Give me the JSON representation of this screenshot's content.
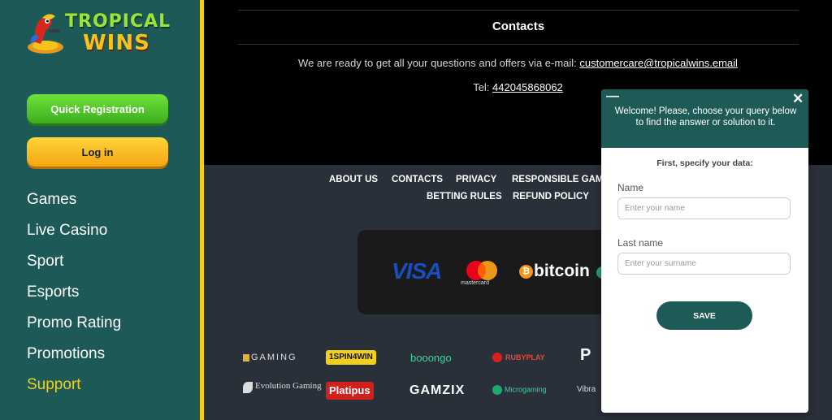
{
  "brand": {
    "line1": "TROPICAL",
    "line2": "WINS"
  },
  "sidebar": {
    "quick_registration": "Quick Registration",
    "login": "Log in",
    "nav": [
      "Games",
      "Live Casino",
      "Sport",
      "Esports",
      "Promo Rating",
      "Promotions",
      "Support"
    ],
    "active_item": "Support"
  },
  "contacts": {
    "title": "Contacts",
    "email_prefix": "We are ready to get all your questions and offers via e-mail: ",
    "email": "customercare@tropicalwins.email",
    "tel_prefix": "Tel: ",
    "tel": "442045868062"
  },
  "footer": {
    "links_row1": [
      "ABOUT US",
      "CONTACTS",
      "PRIVACY",
      "RESPONSIBLE GAMING"
    ],
    "links_row2": [
      "BETTING RULES",
      "REFUND POLICY"
    ],
    "payments": {
      "visa": "VISA",
      "mastercard": "mastercard",
      "bitcoin": "bitcoin"
    },
    "providers": [
      "GAMING",
      "1SPIN4WIN",
      "booongo",
      "RUBYPLAY",
      "POCKET GAMES SOFT",
      "Evolution Gaming",
      "Platipus",
      "GAMZIX",
      "Microgaming",
      "Vibra"
    ]
  },
  "chat": {
    "welcome": "Welcome! Please, choose your query below to find the answer or solution to it.",
    "subtitle": "First, specify your data:",
    "name_label": "Name",
    "name_placeholder": "Enter your name",
    "lastname_label": "Last name",
    "lastname_placeholder": "Enter your surname",
    "save": "SAVE",
    "minimize": "—",
    "close": "✕"
  },
  "colors": {
    "sidebar": "#1d5a57",
    "accent_yellow": "#f2cf1a",
    "chat_header": "#1e5a56"
  }
}
